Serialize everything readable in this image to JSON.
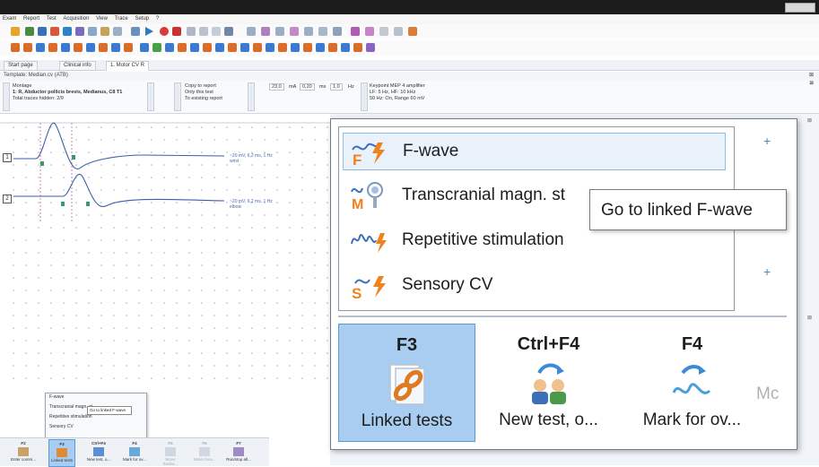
{
  "menubar": {
    "items": [
      "Exam",
      "Report",
      "Test",
      "Acquisition",
      "View",
      "Trace",
      "Setup",
      "?"
    ]
  },
  "tabs": [
    {
      "label": "Start page"
    },
    {
      "label": "Clinical info"
    },
    {
      "label": "1. Motor CV R"
    }
  ],
  "template": {
    "label": "Template: Median.cv (ATB)"
  },
  "montage": {
    "header": "Montage",
    "channel": "1: R, Abductor pollicis brevis, Medianus, C8 T1",
    "hidden": "Total traces hidden: 2/9",
    "copy_to_report": "Copy to report",
    "only_this_test": "Only this test",
    "to_existing_report": "To existing report",
    "stim_values": [
      "23,0",
      "mA",
      "0,20",
      "ms",
      "1,0",
      "Hz"
    ],
    "amp_line1": "Keypoint MEP 4 amplifier",
    "amp_line2": "LF: 5 Hz, HF: 10 kHz",
    "amp_line3": "50 Hz: On, Range 60 mV"
  },
  "traces": {
    "ch1_label": "1",
    "ch2_label": "2",
    "ch1_info_a": "~20 mV, 6,2 ms, 1 Hz",
    "ch1_info_b": "wrist",
    "ch2_info_a": "~20 mV, 6,2 ms, 1 Hz",
    "ch2_info_b": "elbow"
  },
  "mini_popup": {
    "items": [
      "F-wave",
      "Transcranial magn. st",
      "Repetitive stimulation",
      "Sensory CV"
    ],
    "tooltip": "Go to linked F-wave"
  },
  "mini_fn": [
    {
      "key": "F2",
      "label": "Enter comm..."
    },
    {
      "key": "F3",
      "label": "Linked tests"
    },
    {
      "key": "Ctrl+F4",
      "label": "New test, o..."
    },
    {
      "key": "F4",
      "label": "Mark for ov..."
    },
    {
      "key": "F5",
      "label": "Move backw..."
    },
    {
      "key": "F6",
      "label": "Move forw..."
    },
    {
      "key": "F7",
      "label": "Run/stop all..."
    }
  ],
  "popup": {
    "items": [
      {
        "label": "F-wave",
        "icon": "f-wave-icon"
      },
      {
        "label": "Transcranial magn. st",
        "icon": "transcranial-magnetic-icon"
      },
      {
        "label": "Repetitive stimulation",
        "icon": "repetitive-stimulation-icon"
      },
      {
        "label": "Sensory CV",
        "icon": "sensory-cv-icon"
      }
    ],
    "tooltip": "Go to linked F-wave"
  },
  "function_keys": [
    {
      "key": "F3",
      "label": "Linked tests",
      "icon": "linked-tests-icon"
    },
    {
      "key": "Ctrl+F4",
      "label": "New test, o...",
      "icon": "new-test-icon"
    },
    {
      "key": "F4",
      "label": "Mark for ov...",
      "icon": "mark-for-overlay-icon"
    },
    {
      "key": "",
      "label": "Mc",
      "icon": ""
    }
  ],
  "colors": {
    "accent_blue": "#2f6fb5",
    "orange": "#f0821e",
    "trace": "#3b5fa8",
    "highlight": "#a8cdf1"
  }
}
